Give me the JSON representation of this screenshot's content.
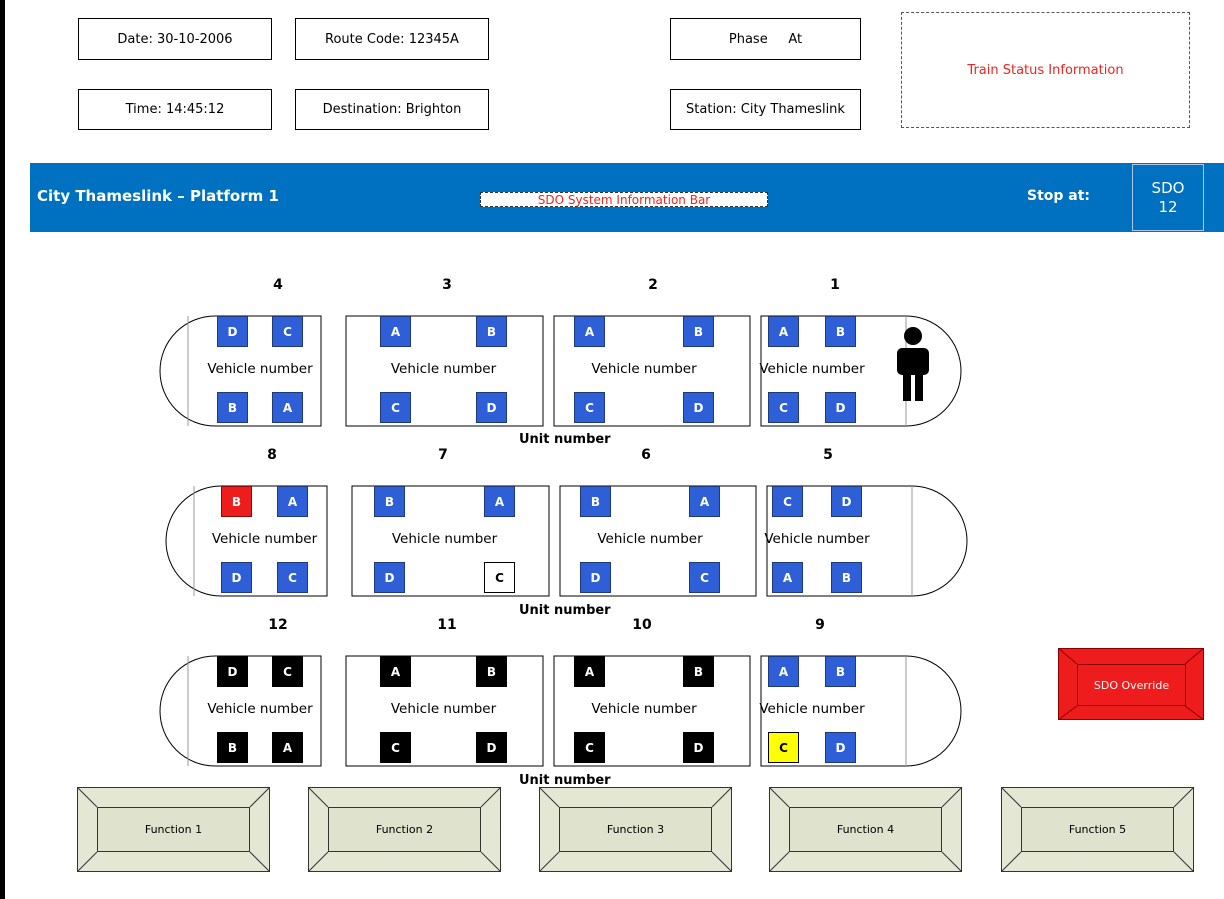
{
  "header": {
    "date": "Date: 30-10-2006",
    "route_code": "Route Code: 12345A",
    "phase": "Phase     At",
    "time": "Time: 14:45:12",
    "destination": "Destination: Brighton",
    "station": "Station: City Thameslink",
    "train_status": "Train Status Information"
  },
  "info_bar": {
    "platform": "City Thameslink – Platform 1",
    "system_info": "SDO System Information Bar",
    "stop_at_label": "Stop at:",
    "sdo_label": "SDO",
    "sdo_value": "12"
  },
  "colors": {
    "bar_blue": "#0070c0",
    "door_blue": "#2e5fd6",
    "door_red": "#ee1d1d",
    "door_black": "#000000",
    "door_yellow": "#ffff00",
    "door_white": "#ffffff",
    "override_red": "#ee1c1c",
    "function_bg": "#e4e7d4",
    "status_text_red": "#e8261f"
  },
  "units": [
    {
      "unit_label": "Unit number",
      "cars": [
        {
          "number": "4",
          "vehicle_label": "Vehicle number",
          "cab": "left",
          "top_doors": [
            {
              "letter": "D",
              "state": "blue"
            },
            {
              "letter": "C",
              "state": "blue"
            }
          ],
          "bottom_doors": [
            {
              "letter": "B",
              "state": "blue"
            },
            {
              "letter": "A",
              "state": "blue"
            }
          ]
        },
        {
          "number": "3",
          "vehicle_label": "Vehicle number",
          "cab": "none",
          "top_doors": [
            {
              "letter": "A",
              "state": "blue"
            },
            {
              "letter": "B",
              "state": "blue"
            }
          ],
          "bottom_doors": [
            {
              "letter": "C",
              "state": "blue"
            },
            {
              "letter": "D",
              "state": "blue"
            }
          ]
        },
        {
          "number": "2",
          "vehicle_label": "Vehicle number",
          "cab": "none",
          "top_doors": [
            {
              "letter": "A",
              "state": "blue"
            },
            {
              "letter": "B",
              "state": "blue"
            }
          ],
          "bottom_doors": [
            {
              "letter": "C",
              "state": "blue"
            },
            {
              "letter": "D",
              "state": "blue"
            }
          ]
        },
        {
          "number": "1",
          "vehicle_label": "Vehicle number",
          "cab": "right",
          "driver": true,
          "top_doors": [
            {
              "letter": "A",
              "state": "blue"
            },
            {
              "letter": "B",
              "state": "blue"
            }
          ],
          "bottom_doors": [
            {
              "letter": "C",
              "state": "blue"
            },
            {
              "letter": "D",
              "state": "blue"
            }
          ]
        }
      ]
    },
    {
      "unit_label": "Unit number",
      "cars": [
        {
          "number": "8",
          "vehicle_label": "Vehicle number",
          "cab": "left",
          "top_doors": [
            {
              "letter": "B",
              "state": "red"
            },
            {
              "letter": "A",
              "state": "blue"
            }
          ],
          "bottom_doors": [
            {
              "letter": "D",
              "state": "blue"
            },
            {
              "letter": "C",
              "state": "blue"
            }
          ]
        },
        {
          "number": "7",
          "vehicle_label": "Vehicle number",
          "cab": "none",
          "top_doors": [
            {
              "letter": "B",
              "state": "blue"
            },
            {
              "letter": "A",
              "state": "blue"
            }
          ],
          "bottom_doors": [
            {
              "letter": "D",
              "state": "blue"
            },
            {
              "letter": "C",
              "state": "white"
            }
          ]
        },
        {
          "number": "6",
          "vehicle_label": "Vehicle number",
          "cab": "none",
          "top_doors": [
            {
              "letter": "B",
              "state": "blue"
            },
            {
              "letter": "A",
              "state": "blue"
            }
          ],
          "bottom_doors": [
            {
              "letter": "D",
              "state": "blue"
            },
            {
              "letter": "C",
              "state": "blue"
            }
          ]
        },
        {
          "number": "5",
          "vehicle_label": "Vehicle number",
          "cab": "right",
          "top_doors": [
            {
              "letter": "C",
              "state": "blue"
            },
            {
              "letter": "D",
              "state": "blue"
            }
          ],
          "bottom_doors": [
            {
              "letter": "A",
              "state": "blue"
            },
            {
              "letter": "B",
              "state": "blue"
            }
          ]
        }
      ]
    },
    {
      "unit_label": "Unit number",
      "cars": [
        {
          "number": "12",
          "vehicle_label": "Vehicle number",
          "cab": "left",
          "top_doors": [
            {
              "letter": "D",
              "state": "black"
            },
            {
              "letter": "C",
              "state": "black"
            }
          ],
          "bottom_doors": [
            {
              "letter": "B",
              "state": "black"
            },
            {
              "letter": "A",
              "state": "black"
            }
          ]
        },
        {
          "number": "11",
          "vehicle_label": "Vehicle number",
          "cab": "none",
          "top_doors": [
            {
              "letter": "A",
              "state": "black"
            },
            {
              "letter": "B",
              "state": "black"
            }
          ],
          "bottom_doors": [
            {
              "letter": "C",
              "state": "black"
            },
            {
              "letter": "D",
              "state": "black"
            }
          ]
        },
        {
          "number": "10",
          "vehicle_label": "Vehicle number",
          "cab": "none",
          "top_doors": [
            {
              "letter": "A",
              "state": "black"
            },
            {
              "letter": "B",
              "state": "black"
            }
          ],
          "bottom_doors": [
            {
              "letter": "C",
              "state": "black"
            },
            {
              "letter": "D",
              "state": "black"
            }
          ]
        },
        {
          "number": "9",
          "vehicle_label": "Vehicle number",
          "cab": "right",
          "top_doors": [
            {
              "letter": "A",
              "state": "blue"
            },
            {
              "letter": "B",
              "state": "blue"
            }
          ],
          "bottom_doors": [
            {
              "letter": "C",
              "state": "yellow"
            },
            {
              "letter": "D",
              "state": "blue"
            }
          ]
        }
      ]
    }
  ],
  "override_label": "SDO Override",
  "functions": [
    "Function 1",
    "Function 2",
    "Function 3",
    "Function 4",
    "Function 5"
  ]
}
